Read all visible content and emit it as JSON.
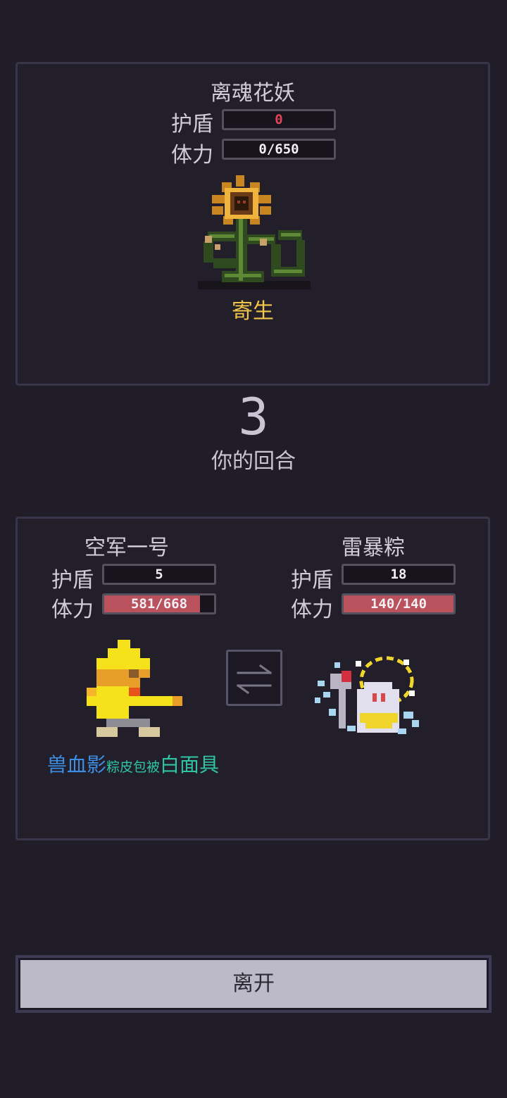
{
  "enemy": {
    "name": "离魂花妖",
    "shield_label": "护盾",
    "shield_value": "0",
    "hp_label": "体力",
    "hp_text": "0/650",
    "hp_fraction": 0,
    "status": "寄生",
    "sprite": "sunflower-monster"
  },
  "turn": {
    "number": "3",
    "label": "你的回合"
  },
  "party": {
    "left": {
      "name": "空军一号",
      "shield_label": "护盾",
      "shield_value": "5",
      "hp_label": "体力",
      "hp_text": "581/668",
      "hp_fraction": 0.87,
      "sprite": "yellow-duck-character"
    },
    "right": {
      "name": "雷暴粽",
      "shield_label": "护盾",
      "shield_value": "18",
      "hp_label": "体力",
      "hp_text": "140/140",
      "hp_fraction": 1.0,
      "sprite": "lightning-zongzi-pet"
    },
    "swap_icon": "swap-arrows-icon",
    "buffs": {
      "part1": "兽血影",
      "part2": "粽皮包被",
      "part3": "白面具"
    }
  },
  "leave_button": "离开",
  "colors": {
    "background": "#201c28",
    "hp_fill": "#b9525c",
    "status_yellow": "#f2c64a",
    "buff_blue": "#3d8fe6",
    "buff_teal": "#2ec4a4"
  }
}
